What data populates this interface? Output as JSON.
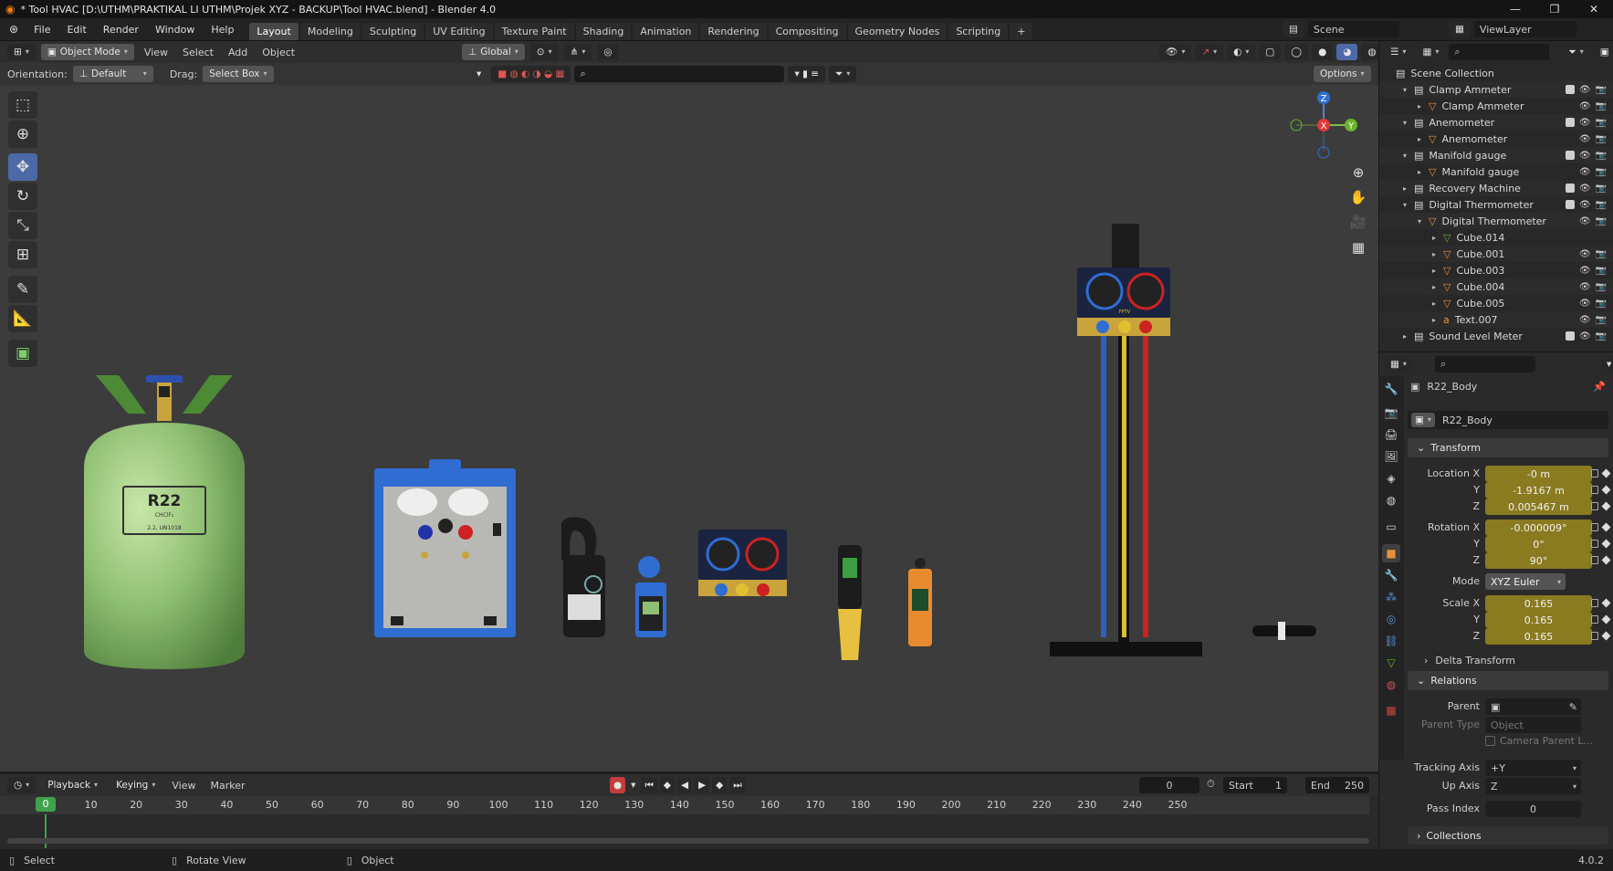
{
  "window": {
    "title": "* Tool HVAC [D:\\UTHM\\PRAKTIKAL LI UTHM\\Projek XYZ - BACKUP\\Tool HVAC.blend] - Blender 4.0",
    "minimize": "—",
    "maximize": "❐",
    "close": "✕"
  },
  "menu": {
    "items": [
      "File",
      "Edit",
      "Render",
      "Window",
      "Help"
    ],
    "workspaces": [
      "Layout",
      "Modeling",
      "Sculpting",
      "UV Editing",
      "Texture Paint",
      "Shading",
      "Animation",
      "Rendering",
      "Compositing",
      "Geometry Nodes",
      "Scripting"
    ],
    "active_workspace": "Layout",
    "add_tab": "+",
    "scene": "Scene",
    "view_layer": "ViewLayer"
  },
  "viewport_header": {
    "mode": "Object Mode",
    "menus": [
      "View",
      "Select",
      "Add",
      "Object"
    ],
    "orientation_space": "Global",
    "orientation_label": "Orientation:",
    "orientation_value": "Default",
    "drag_label": "Drag:",
    "drag_value": "Select Box",
    "options": "Options"
  },
  "viewport_objects": {
    "cylinder_label": "R22",
    "cylinder_sublabel": "CHClF₂",
    "cylinder_code": "2.2, UN1018",
    "manifold_brand": "FPTV"
  },
  "gizmo": {
    "x": "X",
    "y": "Y",
    "z": "Z"
  },
  "timeline": {
    "menus": [
      "Playback",
      "Keying",
      "View",
      "Marker"
    ],
    "current_frame": "0",
    "start_label": "Start",
    "start_value": "1",
    "end_label": "End",
    "end_value": "250",
    "playhead": "0",
    "ticks": [
      "10",
      "20",
      "30",
      "40",
      "50",
      "60",
      "70",
      "80",
      "90",
      "100",
      "110",
      "120",
      "130",
      "140",
      "150",
      "160",
      "170",
      "180",
      "190",
      "200",
      "210",
      "220",
      "230",
      "240",
      "250"
    ]
  },
  "status": {
    "select": "Select",
    "rotate": "Rotate View",
    "object": "Object",
    "version": "4.0.2"
  },
  "outliner": {
    "root": "Scene Collection",
    "rows": [
      {
        "label": "Clamp Ammeter",
        "kind": "collection",
        "depth": 1
      },
      {
        "label": "Clamp Ammeter",
        "kind": "object",
        "depth": 2
      },
      {
        "label": "Anemometer",
        "kind": "collection",
        "depth": 1
      },
      {
        "label": "Anemometer",
        "kind": "object",
        "depth": 2
      },
      {
        "label": "Manifold gauge",
        "kind": "collection",
        "depth": 1
      },
      {
        "label": "Manifold gauge",
        "kind": "object",
        "depth": 2
      },
      {
        "label": "Recovery Machine",
        "kind": "collection",
        "depth": 1
      },
      {
        "label": "Digital Thermometer",
        "kind": "collection",
        "depth": 1
      },
      {
        "label": "Digital Thermometer",
        "kind": "object",
        "depth": 2
      },
      {
        "label": "Cube.014",
        "kind": "mesh",
        "depth": 3
      },
      {
        "label": "Cube.001",
        "kind": "object",
        "depth": 3
      },
      {
        "label": "Cube.003",
        "kind": "object",
        "depth": 3
      },
      {
        "label": "Cube.004",
        "kind": "object",
        "depth": 3
      },
      {
        "label": "Cube.005",
        "kind": "object",
        "depth": 3
      },
      {
        "label": "Text.007",
        "kind": "text",
        "depth": 3
      },
      {
        "label": "Sound Level Meter",
        "kind": "collection",
        "depth": 1
      }
    ]
  },
  "properties": {
    "object_name": "R22_Body",
    "data_name": "R22_Body",
    "transform": "Transform",
    "location_label": "Location X",
    "location": [
      "-0 m",
      "-1.9167 m",
      "0.005467 m"
    ],
    "rotation_label": "Rotation X",
    "rotation": [
      "-0.000009°",
      "0°",
      "90°"
    ],
    "mode_label": "Mode",
    "mode_value": "XYZ Euler",
    "scale_label": "Scale X",
    "scale": [
      "0.165",
      "0.165",
      "0.165"
    ],
    "y": "Y",
    "z": "Z",
    "delta": "Delta Transform",
    "relations": "Relations",
    "parent_label": "Parent",
    "parent_type_label": "Parent Type",
    "parent_type_value": "Object",
    "camera_parent": "Camera Parent L...",
    "tracking_label": "Tracking Axis",
    "tracking_value": "+Y",
    "up_label": "Up Axis",
    "up_value": "Z",
    "pass_label": "Pass Index",
    "pass_value": "0",
    "collections": "Collections"
  }
}
